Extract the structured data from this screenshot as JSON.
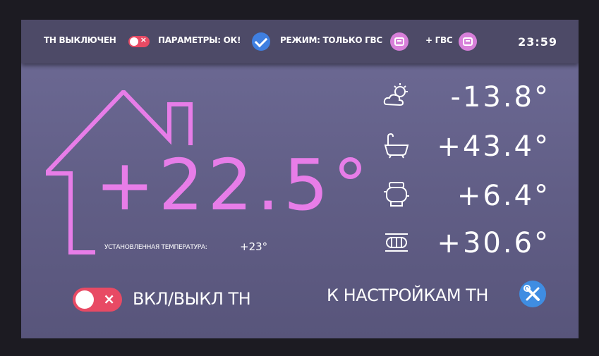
{
  "status_bar": {
    "heat_pump_status": "ТН ВЫКЛЮЧЕН",
    "params_status": "ПАРАМЕТРЫ: ОК!",
    "mode_status": "РЕЖИМ: ТОЛЬКО ГВС",
    "hot_water_extra": "+ ГВС",
    "clock": "23:59"
  },
  "main": {
    "room_temperature": "+22.5°",
    "setpoint_label": "УСТАНОВЛЕННАЯ ТЕМПЕРАТУРА:",
    "setpoint_value": "+23°"
  },
  "readings": [
    {
      "icon": "weather-sun-cloud-icon",
      "value": "-13.8°"
    },
    {
      "icon": "bathtub-icon",
      "value": "+43.4°"
    },
    {
      "icon": "compressor-icon",
      "value": "+6.4°"
    },
    {
      "icon": "heat-exchanger-icon",
      "value": "+30.6°"
    }
  ],
  "controls": {
    "toggle_label": "ВКЛ/ВЫКЛ ТН",
    "settings_label": "К НАСТРОЙКАМ ТН"
  },
  "colors": {
    "accent_pink": "#e77de8",
    "toggle_off": "#e84a64",
    "check_blue": "#3f7fe0"
  }
}
